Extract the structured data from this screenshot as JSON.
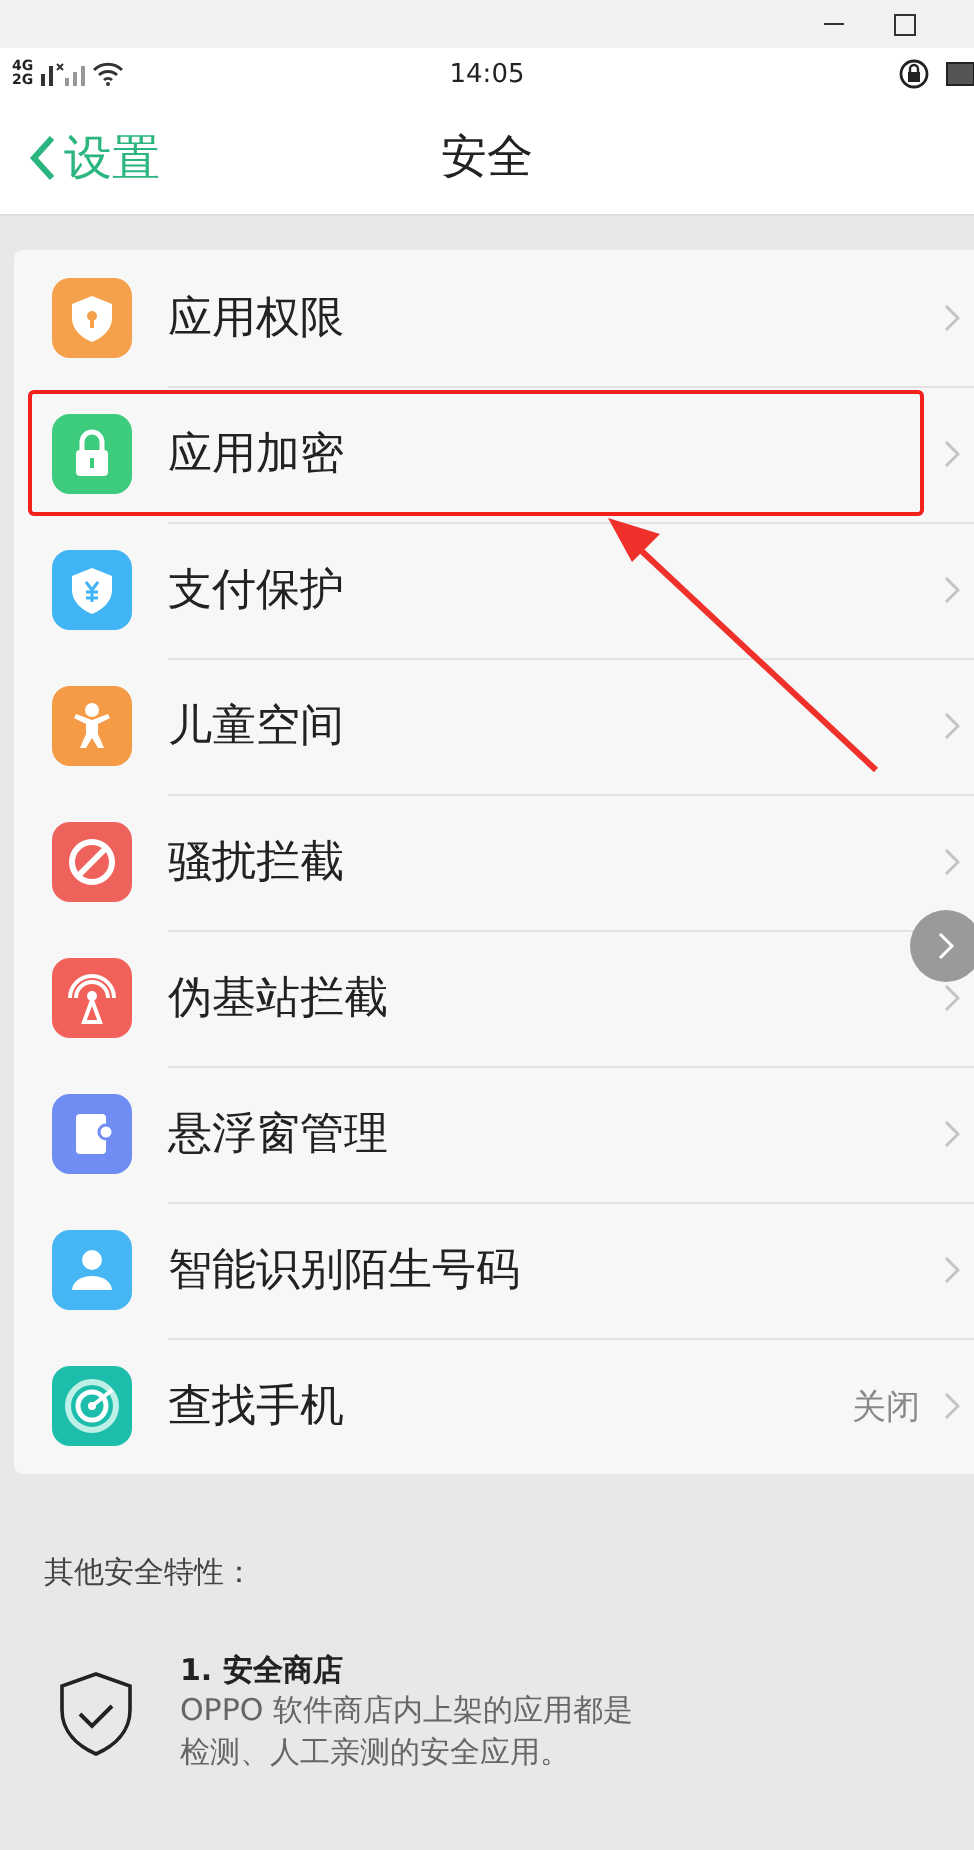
{
  "status_bar": {
    "network_top": "4G",
    "network_bottom": "2G",
    "time": "14:05"
  },
  "nav": {
    "back": "设置",
    "title": "安全"
  },
  "items": [
    {
      "label": "应用权限",
      "color": "#f5a04b",
      "highlighted": false
    },
    {
      "label": "应用加密",
      "color": "#3dcb7e",
      "highlighted": true
    },
    {
      "label": "支付保护",
      "color": "#41b4f5",
      "highlighted": false
    },
    {
      "label": "儿童空间",
      "color": "#f59a45",
      "highlighted": false
    },
    {
      "label": "骚扰拦截",
      "color": "#ef625c",
      "highlighted": false
    },
    {
      "label": "伪基站拦截",
      "color": "#f26159",
      "highlighted": false
    },
    {
      "label": "悬浮窗管理",
      "color": "#6f8df3",
      "highlighted": false
    },
    {
      "label": "智能识别陌生号码",
      "color": "#45b5f3",
      "highlighted": false
    },
    {
      "label": "查找手机",
      "color": "#1dbdab",
      "value": "关闭",
      "highlighted": false
    }
  ],
  "section_title": "其他安全特性：",
  "features": [
    {
      "title": "1. 安全商店",
      "lines": [
        "OPPO 软件商店内上架的应用都是",
        "检测、人工亲测的安全应用。"
      ]
    }
  ]
}
